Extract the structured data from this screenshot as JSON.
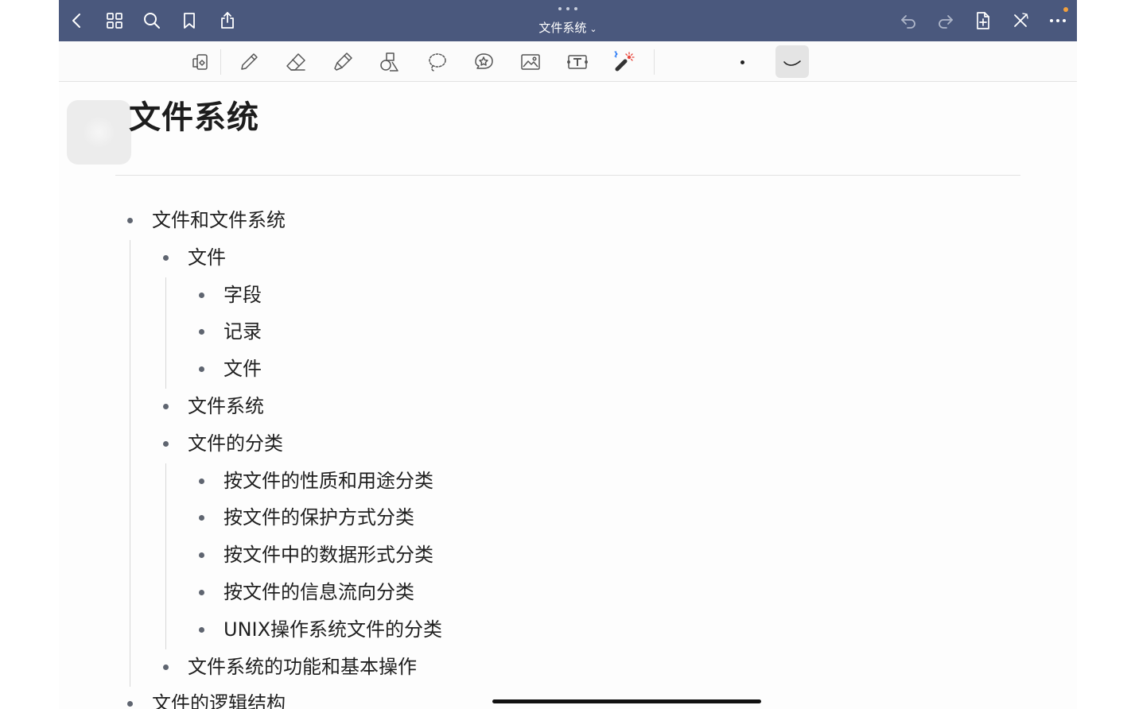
{
  "navbar": {
    "title": "文件系统",
    "title_chevron": "⌄",
    "bg_color": "#4a587d",
    "notification_color": "#f2a03d",
    "left_buttons": [
      "back-icon",
      "grid-icon",
      "search-icon",
      "bookmark-icon",
      "share-icon"
    ],
    "right_buttons": [
      "undo-icon",
      "redo-icon",
      "add-page-icon",
      "close-icon",
      "more-icon"
    ]
  },
  "toolbar": {
    "tools": [
      "tablet-mode-icon",
      "pen-icon",
      "eraser-icon",
      "highlighter-icon",
      "shapes-icon",
      "lasso-icon",
      "sticker-icon",
      "image-icon",
      "text-box-icon",
      "laser-pointer-icon"
    ],
    "selected_option": "stroke-style-icon",
    "accent_color": "#e8443a",
    "bluetooth_color": "#2f7ef6"
  },
  "page": {
    "title": "文件系统",
    "outline": [
      {
        "level": 0,
        "text": "文件和文件系统"
      },
      {
        "level": 1,
        "text": "文件"
      },
      {
        "level": 2,
        "text": "字段"
      },
      {
        "level": 2,
        "text": "记录"
      },
      {
        "level": 2,
        "text": "文件"
      },
      {
        "level": 1,
        "text": "文件系统"
      },
      {
        "level": 1,
        "text": "文件的分类"
      },
      {
        "level": 2,
        "text": "按文件的性质和用途分类"
      },
      {
        "level": 2,
        "text": "按文件的保护方式分类"
      },
      {
        "level": 2,
        "text": "按文件中的数据形式分类"
      },
      {
        "level": 2,
        "text": "按文件的信息流向分类"
      },
      {
        "level": 2,
        "text": "UNIX操作系统文件的分类"
      },
      {
        "level": 1,
        "text": "文件系统的功能和基本操作"
      },
      {
        "level": 0,
        "text": "文件的逻辑结构"
      }
    ]
  }
}
